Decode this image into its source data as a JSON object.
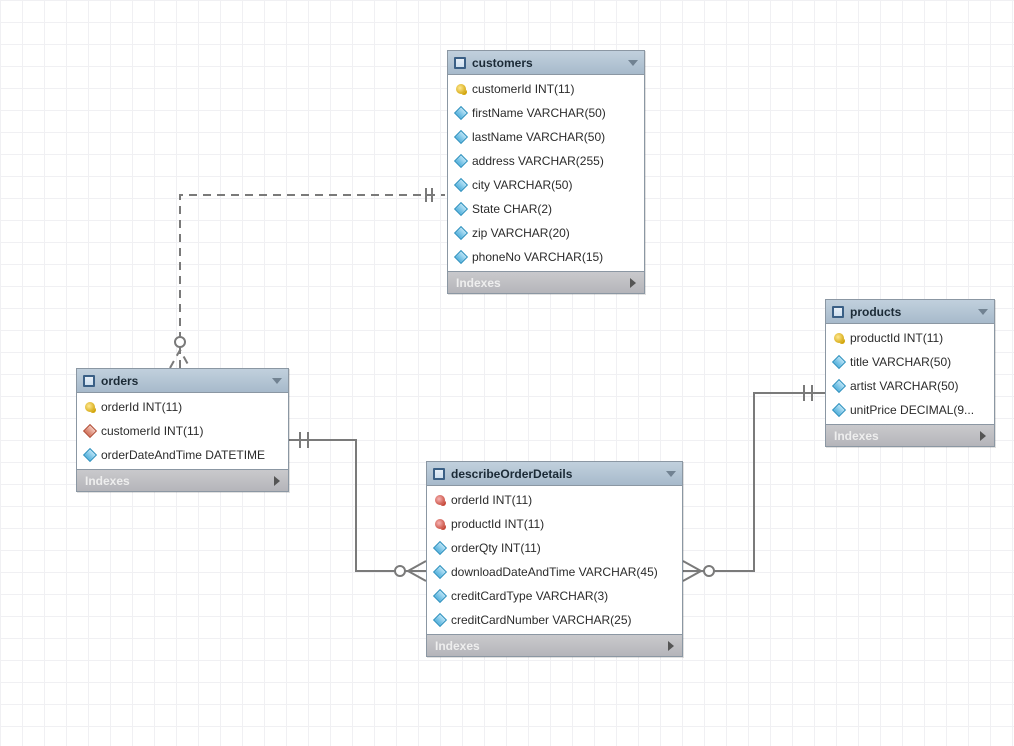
{
  "labels": {
    "indexes": "Indexes"
  },
  "tables": {
    "customers": {
      "title": "customers",
      "cols": [
        "customerId INT(11)",
        "firstName VARCHAR(50)",
        "lastName VARCHAR(50)",
        "address VARCHAR(255)",
        "city VARCHAR(50)",
        "State CHAR(2)",
        "zip VARCHAR(20)",
        "phoneNo VARCHAR(15)"
      ]
    },
    "orders": {
      "title": "orders",
      "cols": [
        "orderId INT(11)",
        "customerId INT(11)",
        "orderDateAndTime DATETIME"
      ]
    },
    "describeOrderDetails": {
      "title": "describeOrderDetails",
      "cols": [
        "orderId INT(11)",
        "productId INT(11)",
        "orderQty INT(11)",
        "downloadDateAndTime VARCHAR(45)",
        "creditCardType VARCHAR(3)",
        "creditCardNumber VARCHAR(25)"
      ]
    },
    "products": {
      "title": "products",
      "cols": [
        "productId INT(11)",
        "title VARCHAR(50)",
        "artist VARCHAR(50)",
        "unitPrice DECIMAL(9..."
      ]
    }
  }
}
